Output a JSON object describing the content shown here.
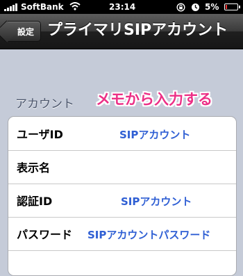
{
  "status_bar": {
    "carrier": "SoftBank",
    "time": "23:14",
    "battery": "5%",
    "icons": [
      "signal-icon",
      "wifi-icon",
      "rotation-lock-icon",
      "alarm-icon",
      "battery-icon"
    ],
    "battery_level": 0.05
  },
  "nav": {
    "back_label": "設定",
    "title": "プライマリSIPアカウント"
  },
  "section": {
    "header": "アカウント",
    "annotation": "メモから入力する"
  },
  "rows": [
    {
      "label": "ユーザID",
      "note": "SIPアカウント"
    },
    {
      "label": "表示名",
      "note": ""
    },
    {
      "label": "認証ID",
      "note": "SIPアカウント"
    },
    {
      "label": "パスワード",
      "note": "SIPアカウントパスワード"
    }
  ],
  "colors": {
    "background": "#c5cbd8",
    "annotation_pink": "#ec2f86",
    "annotation_blue": "#2f5fd4",
    "section_header": "#4c566c"
  }
}
